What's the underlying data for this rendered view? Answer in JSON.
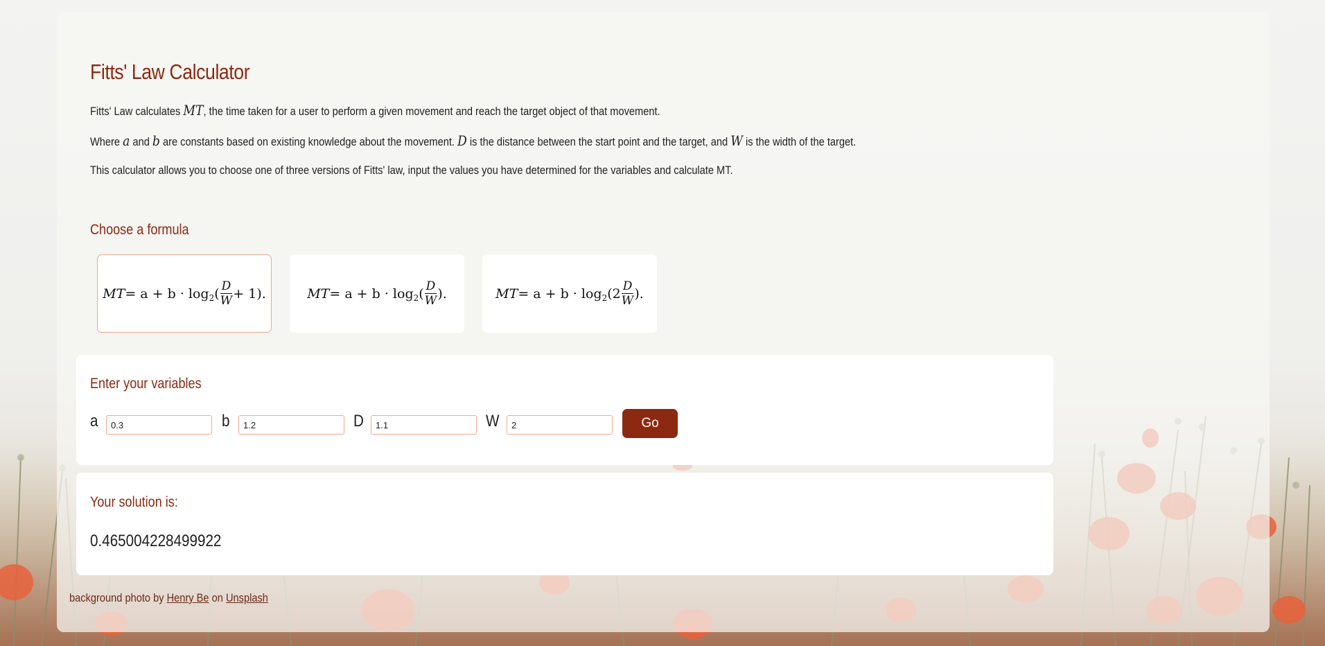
{
  "page": {
    "title": "Fitts' Law Calculator",
    "intro": {
      "p1_before": "Fitts' Law calculates ",
      "p1_math": "MT",
      "p1_after": ", the time taken for a user to perform a given movement and reach the target object of that movement.",
      "p2_a_pre": "Where ",
      "p2_a": "a",
      "p2_and": " and ",
      "p2_b": "b",
      "p2_mid": " are constants based on existing knowledge about the movement. ",
      "p2_D": "D",
      "p2_mid2": " is the distance between the start point and the target, and ",
      "p2_W": "W",
      "p2_end": " is the width of the target.",
      "p3": "This calculator allows you to choose one of three versions of Fitts' law, input the values you have determined for the variables and calculate MT."
    }
  },
  "formulas": {
    "heading": "Choose a formula",
    "selected_index": 0,
    "items": [
      {
        "lhs": "MT",
        "eq": " = a + b · log",
        "sub": "2",
        "open": "(",
        "num": "D",
        "den": "W",
        "tail": " + 1)."
      },
      {
        "lhs": "MT",
        "eq": " = a + b · log",
        "sub": "2",
        "open": "(",
        "num": "D",
        "den": "W",
        "tail": ")."
      },
      {
        "lhs": "MT",
        "eq": " = a + b · log",
        "sub": "2",
        "open": "(2",
        "num": "D",
        "den": "W",
        "tail": ")."
      }
    ]
  },
  "variables": {
    "heading": "Enter your variables",
    "a": {
      "label": "a",
      "value": "0.3"
    },
    "b": {
      "label": "b",
      "value": "1.2"
    },
    "D": {
      "label": "D",
      "value": "1.1"
    },
    "W": {
      "label": "W",
      "value": "2"
    },
    "go_label": "Go"
  },
  "solution": {
    "heading": "Your solution is:",
    "value": "0.465004228499922"
  },
  "credit": {
    "before": "background photo by ",
    "author": "Henry Be",
    "on": " on ",
    "site": "Unsplash"
  },
  "colors": {
    "accent": "#8b2a10",
    "selected_border": "#f0a98e",
    "poppy": "#e8623c"
  }
}
